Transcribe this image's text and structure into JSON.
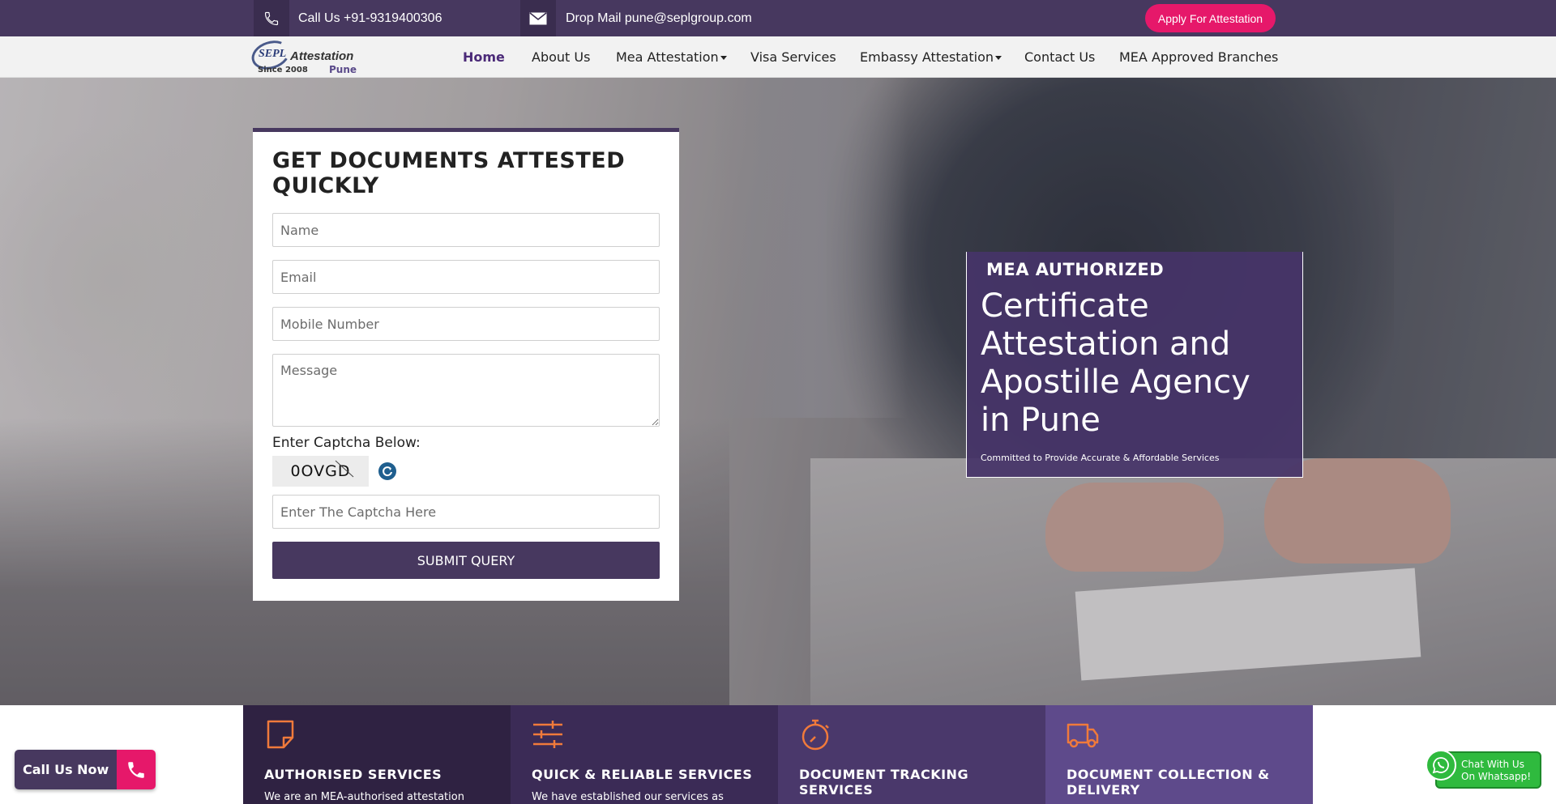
{
  "topbar": {
    "call_text": "Call Us +91-9319400306",
    "mail_text": "Drop Mail  pune@seplgroup.com",
    "apply_label": "Apply For Attestation"
  },
  "logo": {
    "mark": "SEPL",
    "name": "Attestation",
    "since": "Since 2008",
    "city": "Pune"
  },
  "nav": {
    "items": [
      "Home",
      "About Us",
      "Mea Attestation",
      "Visa Services",
      "Embassy Attestation",
      "Contact Us",
      "MEA Approved Branches"
    ]
  },
  "form": {
    "title": "GET DOCUMENTS ATTESTED QUICKLY",
    "name_placeholder": "Name",
    "email_placeholder": "Email",
    "mobile_placeholder": "Mobile Number",
    "message_placeholder": "Message",
    "captcha_label": "Enter Captcha Below:",
    "captcha_code": "0OVGD",
    "captcha_placeholder": "Enter The Captcha Here",
    "submit_label": "SUBMIT QUERY"
  },
  "hero": {
    "kicker": "MEA AUTHORIZED",
    "title": "Certificate Attestation and Apostille Agency in Pune",
    "subtitle": "Committed to Provide Accurate & Affordable Services"
  },
  "features": [
    {
      "icon": "document-icon",
      "title": "AUTHORISED SERVICES",
      "text": "We are an MEA-authorised attestation",
      "bg": "#2f2242"
    },
    {
      "icon": "sliders-icon",
      "title": "QUICK & RELIABLE SERVICES",
      "text": "We have established our services as highly",
      "bg": "#3b2b56"
    },
    {
      "icon": "stopwatch-icon",
      "title": "DOCUMENT TRACKING SERVICES",
      "text": "",
      "bg": "#4a386b"
    },
    {
      "icon": "truck-icon",
      "title": "DOCUMENT COLLECTION & DELIVERY",
      "text": "",
      "bg": "#5e4a8b"
    }
  ],
  "widgets": {
    "call_now": "Call Us Now",
    "whatsapp_line1": "Chat With Us",
    "whatsapp_line2": "On Whatsapp!"
  },
  "colors": {
    "brand_purple": "#47385f",
    "accent_pink": "#e6186a",
    "icon_orange": "#f07a3b",
    "whatsapp_green": "#2fba3e"
  }
}
